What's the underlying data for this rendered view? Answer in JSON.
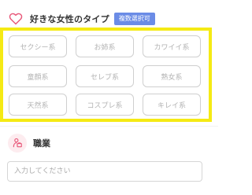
{
  "type_section": {
    "title": "好きな女性のタイプ",
    "badge": "複数選択可",
    "options": [
      "セクシー系",
      "お姉系",
      "カワイイ系",
      "童顔系",
      "セレブ系",
      "熟女系",
      "天然系",
      "コスプレ系",
      "キレイ系"
    ]
  },
  "job_section": {
    "label": "職業",
    "placeholder": "入力してください",
    "value": ""
  },
  "colors": {
    "highlight": "#f5ea14",
    "badge": "#6b8ce6",
    "accent_pink": "#e8597a"
  },
  "icons": [
    "heart-outline-icon",
    "briefcase-person-icon"
  ]
}
